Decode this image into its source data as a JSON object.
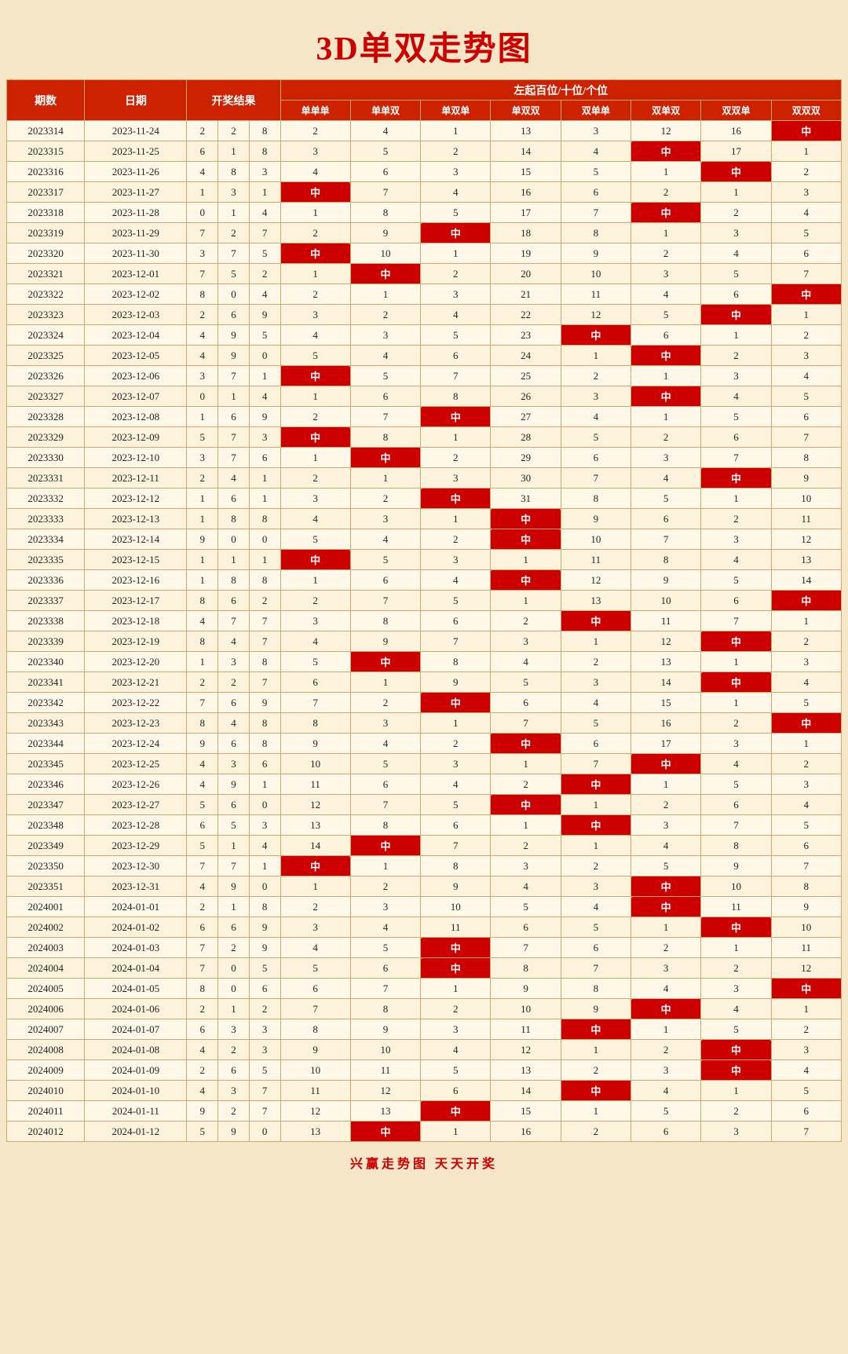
{
  "title": "3D单双走势图",
  "footer": "兴赢走势图    天天开奖",
  "headers": {
    "qishu": "期数",
    "date": "日期",
    "result": "开奖结果",
    "group": "左起百位/十位/个位",
    "cols": [
      "单单单",
      "单单双",
      "单双单",
      "单双双",
      "双单单",
      "双单双",
      "双双单",
      "双双双"
    ]
  },
  "rows": [
    {
      "id": "2023314",
      "date": "2023-11-24",
      "r": [
        2,
        2,
        8
      ],
      "vals": [
        2,
        4,
        1,
        13,
        3,
        12,
        16,
        "中"
      ]
    },
    {
      "id": "2023315",
      "date": "2023-11-25",
      "r": [
        6,
        1,
        8
      ],
      "vals": [
        3,
        5,
        2,
        14,
        4,
        "中",
        17,
        1
      ]
    },
    {
      "id": "2023316",
      "date": "2023-11-26",
      "r": [
        4,
        8,
        3
      ],
      "vals": [
        4,
        6,
        3,
        15,
        5,
        1,
        "中",
        2
      ]
    },
    {
      "id": "2023317",
      "date": "2023-11-27",
      "r": [
        1,
        3,
        1
      ],
      "vals": [
        "中",
        7,
        4,
        16,
        6,
        2,
        1,
        3
      ]
    },
    {
      "id": "2023318",
      "date": "2023-11-28",
      "r": [
        0,
        1,
        4
      ],
      "vals": [
        1,
        8,
        5,
        17,
        7,
        "中",
        2,
        4
      ]
    },
    {
      "id": "2023319",
      "date": "2023-11-29",
      "r": [
        7,
        2,
        7
      ],
      "vals": [
        2,
        9,
        "中",
        18,
        8,
        1,
        3,
        5
      ]
    },
    {
      "id": "2023320",
      "date": "2023-11-30",
      "r": [
        3,
        7,
        5
      ],
      "vals": [
        "中",
        10,
        1,
        19,
        9,
        2,
        4,
        6
      ]
    },
    {
      "id": "2023321",
      "date": "2023-12-01",
      "r": [
        7,
        5,
        2
      ],
      "vals": [
        1,
        "中",
        2,
        20,
        10,
        3,
        5,
        7
      ]
    },
    {
      "id": "2023322",
      "date": "2023-12-02",
      "r": [
        8,
        0,
        4
      ],
      "vals": [
        2,
        1,
        3,
        21,
        11,
        4,
        6,
        "中"
      ]
    },
    {
      "id": "2023323",
      "date": "2023-12-03",
      "r": [
        2,
        6,
        9
      ],
      "vals": [
        3,
        2,
        4,
        22,
        12,
        5,
        "中",
        1
      ]
    },
    {
      "id": "2023324",
      "date": "2023-12-04",
      "r": [
        4,
        9,
        5
      ],
      "vals": [
        4,
        3,
        5,
        23,
        "中",
        6,
        1,
        2
      ]
    },
    {
      "id": "2023325",
      "date": "2023-12-05",
      "r": [
        4,
        9,
        0
      ],
      "vals": [
        5,
        4,
        6,
        24,
        1,
        "中",
        2,
        3
      ]
    },
    {
      "id": "2023326",
      "date": "2023-12-06",
      "r": [
        3,
        7,
        1
      ],
      "vals": [
        "中",
        5,
        7,
        25,
        2,
        1,
        3,
        4
      ]
    },
    {
      "id": "2023327",
      "date": "2023-12-07",
      "r": [
        0,
        1,
        4
      ],
      "vals": [
        1,
        6,
        8,
        26,
        3,
        "中",
        4,
        5
      ]
    },
    {
      "id": "2023328",
      "date": "2023-12-08",
      "r": [
        1,
        6,
        9
      ],
      "vals": [
        2,
        7,
        "中",
        27,
        4,
        1,
        5,
        6
      ]
    },
    {
      "id": "2023329",
      "date": "2023-12-09",
      "r": [
        5,
        7,
        3
      ],
      "vals": [
        "中",
        8,
        1,
        28,
        5,
        2,
        6,
        7
      ]
    },
    {
      "id": "2023330",
      "date": "2023-12-10",
      "r": [
        3,
        7,
        6
      ],
      "vals": [
        1,
        "中",
        2,
        29,
        6,
        3,
        7,
        8
      ]
    },
    {
      "id": "2023331",
      "date": "2023-12-11",
      "r": [
        2,
        4,
        1
      ],
      "vals": [
        2,
        1,
        3,
        30,
        7,
        4,
        "中",
        9
      ]
    },
    {
      "id": "2023332",
      "date": "2023-12-12",
      "r": [
        1,
        6,
        1
      ],
      "vals": [
        3,
        2,
        "中",
        31,
        8,
        5,
        1,
        10
      ]
    },
    {
      "id": "2023333",
      "date": "2023-12-13",
      "r": [
        1,
        8,
        8
      ],
      "vals": [
        4,
        3,
        1,
        "中",
        9,
        6,
        2,
        11
      ]
    },
    {
      "id": "2023334",
      "date": "2023-12-14",
      "r": [
        9,
        0,
        0
      ],
      "vals": [
        5,
        4,
        2,
        "中",
        10,
        7,
        3,
        12
      ]
    },
    {
      "id": "2023335",
      "date": "2023-12-15",
      "r": [
        1,
        1,
        1
      ],
      "vals": [
        "中",
        5,
        3,
        1,
        11,
        8,
        4,
        13
      ]
    },
    {
      "id": "2023336",
      "date": "2023-12-16",
      "r": [
        1,
        8,
        8
      ],
      "vals": [
        1,
        6,
        4,
        "中",
        12,
        9,
        5,
        14
      ]
    },
    {
      "id": "2023337",
      "date": "2023-12-17",
      "r": [
        8,
        6,
        2
      ],
      "vals": [
        2,
        7,
        5,
        1,
        13,
        10,
        6,
        "中"
      ]
    },
    {
      "id": "2023338",
      "date": "2023-12-18",
      "r": [
        4,
        7,
        7
      ],
      "vals": [
        3,
        8,
        6,
        2,
        "中",
        11,
        7,
        1
      ]
    },
    {
      "id": "2023339",
      "date": "2023-12-19",
      "r": [
        8,
        4,
        7
      ],
      "vals": [
        4,
        9,
        7,
        3,
        1,
        12,
        "中",
        2
      ]
    },
    {
      "id": "2023340",
      "date": "2023-12-20",
      "r": [
        1,
        3,
        8
      ],
      "vals": [
        5,
        "中",
        8,
        4,
        2,
        13,
        1,
        3
      ]
    },
    {
      "id": "2023341",
      "date": "2023-12-21",
      "r": [
        2,
        2,
        7
      ],
      "vals": [
        6,
        1,
        9,
        5,
        3,
        14,
        "中",
        4
      ]
    },
    {
      "id": "2023342",
      "date": "2023-12-22",
      "r": [
        7,
        6,
        9
      ],
      "vals": [
        7,
        2,
        "中",
        6,
        4,
        15,
        1,
        5
      ]
    },
    {
      "id": "2023343",
      "date": "2023-12-23",
      "r": [
        8,
        4,
        8
      ],
      "vals": [
        8,
        3,
        1,
        7,
        5,
        16,
        2,
        "中"
      ]
    },
    {
      "id": "2023344",
      "date": "2023-12-24",
      "r": [
        9,
        6,
        8
      ],
      "vals": [
        9,
        4,
        2,
        "中",
        6,
        17,
        3,
        1
      ]
    },
    {
      "id": "2023345",
      "date": "2023-12-25",
      "r": [
        4,
        3,
        6
      ],
      "vals": [
        10,
        5,
        3,
        1,
        7,
        "中",
        4,
        2
      ]
    },
    {
      "id": "2023346",
      "date": "2023-12-26",
      "r": [
        4,
        9,
        1
      ],
      "vals": [
        11,
        6,
        4,
        2,
        "中",
        1,
        5,
        3
      ]
    },
    {
      "id": "2023347",
      "date": "2023-12-27",
      "r": [
        5,
        6,
        0
      ],
      "vals": [
        12,
        7,
        5,
        "中",
        1,
        2,
        6,
        4
      ]
    },
    {
      "id": "2023348",
      "date": "2023-12-28",
      "r": [
        6,
        5,
        3
      ],
      "vals": [
        13,
        8,
        6,
        1,
        "中",
        3,
        7,
        5
      ]
    },
    {
      "id": "2023349",
      "date": "2023-12-29",
      "r": [
        5,
        1,
        4
      ],
      "vals": [
        14,
        "中",
        7,
        2,
        1,
        4,
        8,
        6
      ]
    },
    {
      "id": "2023350",
      "date": "2023-12-30",
      "r": [
        7,
        7,
        1
      ],
      "vals": [
        "中",
        1,
        8,
        3,
        2,
        5,
        9,
        7
      ]
    },
    {
      "id": "2023351",
      "date": "2023-12-31",
      "r": [
        4,
        9,
        0
      ],
      "vals": [
        1,
        2,
        9,
        4,
        3,
        "中",
        10,
        8
      ]
    },
    {
      "id": "2024001",
      "date": "2024-01-01",
      "r": [
        2,
        1,
        8
      ],
      "vals": [
        2,
        3,
        10,
        5,
        4,
        "中",
        11,
        9
      ]
    },
    {
      "id": "2024002",
      "date": "2024-01-02",
      "r": [
        6,
        6,
        9
      ],
      "vals": [
        3,
        4,
        11,
        6,
        5,
        1,
        "中",
        10
      ]
    },
    {
      "id": "2024003",
      "date": "2024-01-03",
      "r": [
        7,
        2,
        9
      ],
      "vals": [
        4,
        5,
        "中",
        7,
        6,
        2,
        1,
        11
      ]
    },
    {
      "id": "2024004",
      "date": "2024-01-04",
      "r": [
        7,
        0,
        5
      ],
      "vals": [
        5,
        6,
        "中",
        8,
        7,
        3,
        2,
        12
      ]
    },
    {
      "id": "2024005",
      "date": "2024-01-05",
      "r": [
        8,
        0,
        6
      ],
      "vals": [
        6,
        7,
        1,
        9,
        8,
        4,
        3,
        "中"
      ]
    },
    {
      "id": "2024006",
      "date": "2024-01-06",
      "r": [
        2,
        1,
        2
      ],
      "vals": [
        7,
        8,
        2,
        10,
        9,
        "中",
        4,
        1
      ]
    },
    {
      "id": "2024007",
      "date": "2024-01-07",
      "r": [
        6,
        3,
        3
      ],
      "vals": [
        8,
        9,
        3,
        11,
        "中",
        1,
        5,
        2
      ]
    },
    {
      "id": "2024008",
      "date": "2024-01-08",
      "r": [
        4,
        2,
        3
      ],
      "vals": [
        9,
        10,
        4,
        12,
        1,
        2,
        "中",
        3
      ]
    },
    {
      "id": "2024009",
      "date": "2024-01-09",
      "r": [
        2,
        6,
        5
      ],
      "vals": [
        10,
        11,
        5,
        13,
        2,
        3,
        "中",
        4
      ]
    },
    {
      "id": "2024010",
      "date": "2024-01-10",
      "r": [
        4,
        3,
        7
      ],
      "vals": [
        11,
        12,
        6,
        14,
        "中",
        4,
        1,
        5
      ]
    },
    {
      "id": "2024011",
      "date": "2024-01-11",
      "r": [
        9,
        2,
        7
      ],
      "vals": [
        12,
        13,
        "中",
        15,
        1,
        5,
        2,
        6
      ]
    },
    {
      "id": "2024012",
      "date": "2024-01-12",
      "r": [
        5,
        9,
        0
      ],
      "vals": [
        13,
        "中",
        1,
        16,
        2,
        6,
        3,
        7
      ]
    }
  ]
}
